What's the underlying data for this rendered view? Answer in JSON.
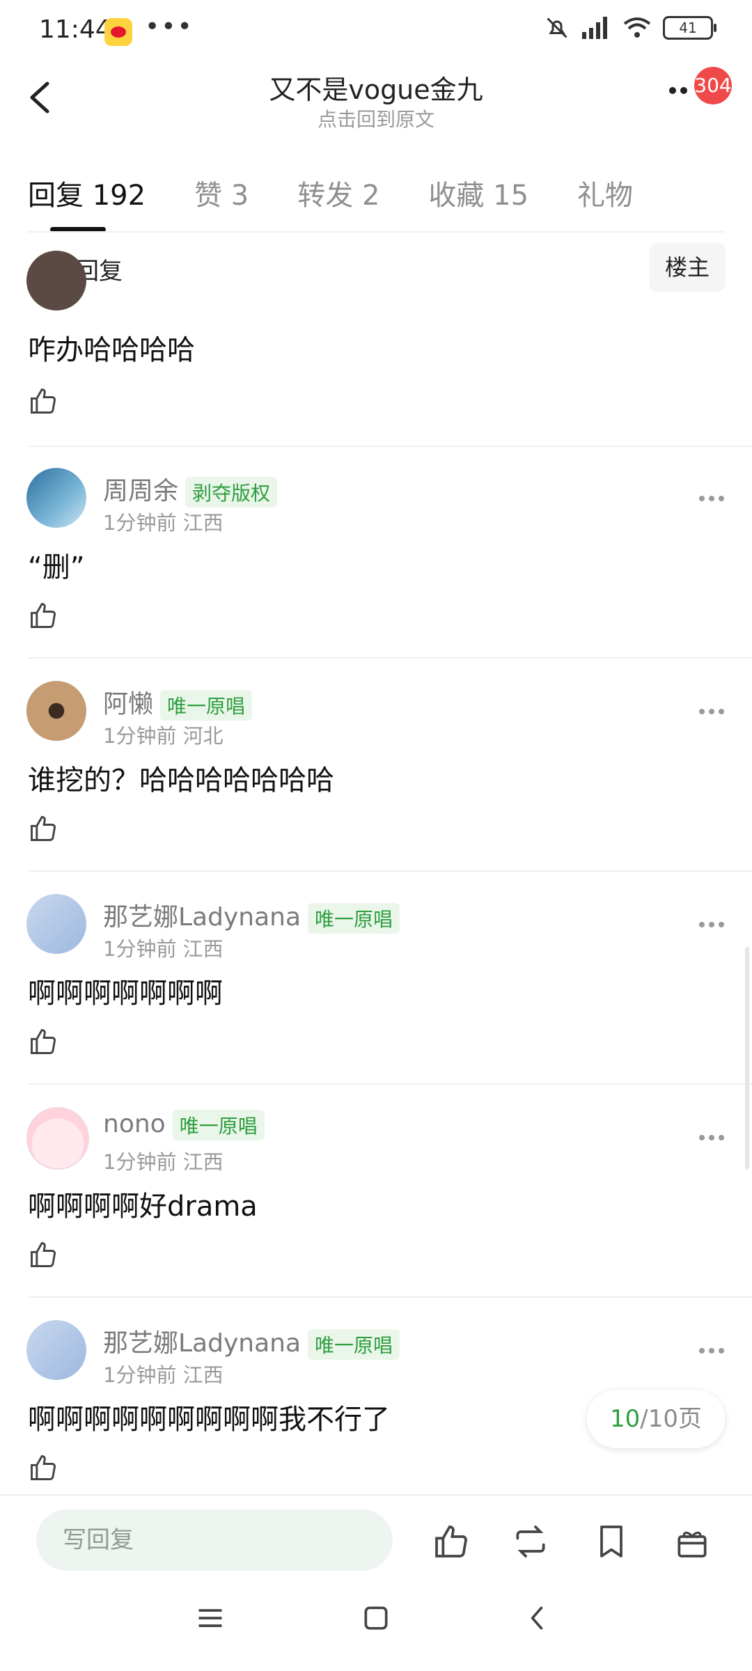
{
  "status_bar": {
    "time": "11:44",
    "more_dots": "•••",
    "battery": "41"
  },
  "header": {
    "title": "又不是vogue金九",
    "subtitle": "点击回到原文",
    "badge_count": "304"
  },
  "tabs": [
    {
      "label": "回复 192"
    },
    {
      "label": "赞 3"
    },
    {
      "label": "转发 2"
    },
    {
      "label": "收藏 15"
    },
    {
      "label": "礼物"
    }
  ],
  "filter": {
    "label": "全部回复",
    "op_button": "楼主"
  },
  "comments": [
    {
      "content": "咋办哈哈哈哈"
    },
    {
      "name": "周周余",
      "tag": "剥夺版权",
      "meta": "1分钟前 江西",
      "content": "“删”"
    },
    {
      "name": "阿懒",
      "tag": "唯一原唱",
      "meta": "1分钟前 河北",
      "content": "谁挖的？哈哈哈哈哈哈哈"
    },
    {
      "name": "那艺娜Ladynana",
      "tag": "唯一原唱",
      "meta": "1分钟前 江西",
      "content": "啊啊啊啊啊啊啊"
    },
    {
      "name": "nono",
      "tag": "唯一原唱",
      "meta": "1分钟前 江西",
      "content": "啊啊啊啊好drama"
    },
    {
      "name": "那艺娜Ladynana",
      "tag": "唯一原唱",
      "meta": "1分钟前 江西",
      "content": "啊啊啊啊啊啊啊啊啊我不行了"
    }
  ],
  "pager": {
    "current": "10",
    "rest": "/10页",
    "progress_fraction": 1.0
  },
  "toolbar": {
    "reply_placeholder": "写回复"
  },
  "colors": {
    "accent_green": "#2e9e3f",
    "badge_red": "#f0494a"
  }
}
